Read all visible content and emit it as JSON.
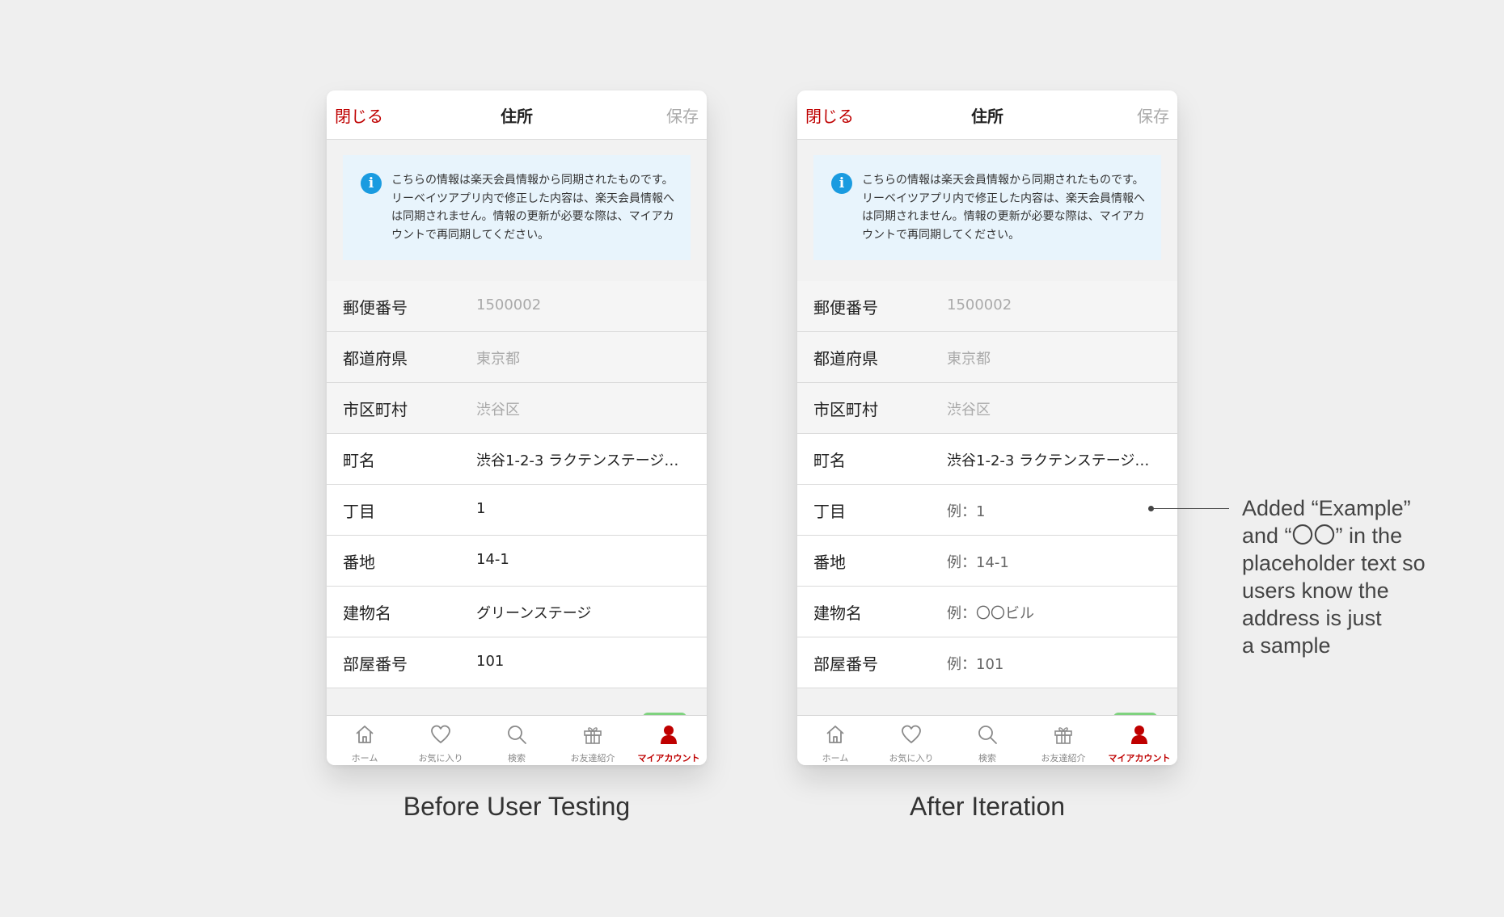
{
  "screens": [
    {
      "nav": {
        "close": "閉じる",
        "title": "住所",
        "save": "保存"
      },
      "notice": "こちらの情報は楽天会員情報から同期されたものです。リーベイツアプリ内で修正した内容は、楽天会員情報へは同期されません。情報の更新が必要な際は、マイアカウントで再同期してください。",
      "fields": [
        {
          "label": "郵便番号",
          "value": "1500002"
        },
        {
          "label": "都道府県",
          "value": "東京都"
        },
        {
          "label": "市区町村",
          "value": "渋谷区"
        },
        {
          "label": "町名",
          "value": "渋谷1-2-3 ラクテンステージ…"
        },
        {
          "label": "丁目",
          "value": "1"
        },
        {
          "label": "番地",
          "value": "14-1"
        },
        {
          "label": "建物名",
          "value": "グリーンステージ"
        },
        {
          "label": "部屋番号",
          "value": "101"
        }
      ],
      "tabs": [
        "ホーム",
        "お気に入り",
        "検索",
        "お友達紹介",
        "マイアカウント"
      ],
      "caption": "Before User Testing"
    },
    {
      "nav": {
        "close": "閉じる",
        "title": "住所",
        "save": "保存"
      },
      "notice": "こちらの情報は楽天会員情報から同期されたものです。リーベイツアプリ内で修正した内容は、楽天会員情報へは同期されません。情報の更新が必要な際は、マイアカウントで再同期してください。",
      "fields": [
        {
          "label": "郵便番号",
          "value": "1500002"
        },
        {
          "label": "都道府県",
          "value": "東京都"
        },
        {
          "label": "市区町村",
          "value": "渋谷区"
        },
        {
          "label": "町名",
          "value": "渋谷1-2-3 ラクテンステージ…"
        },
        {
          "label": "丁目",
          "value": "例：1"
        },
        {
          "label": "番地",
          "value": "例：14-1"
        },
        {
          "label": "建物名",
          "value": "例：〇〇ビル"
        },
        {
          "label": "部屋番号",
          "value": "例：101"
        }
      ],
      "tabs": [
        "ホーム",
        "お気に入り",
        "検索",
        "お友達紹介",
        "マイアカウント"
      ],
      "caption": "After Iteration"
    }
  ],
  "annotation": {
    "lines": [
      "Added “Example”",
      "and “〇〇” in the",
      "placeholder text so",
      "users know the",
      "address is just",
      "a sample"
    ]
  },
  "colors": {
    "brand_red": "#bf0000",
    "info_blue": "#1a9be0",
    "notice_bg": "#e8f4fc"
  },
  "icons": [
    "home-icon",
    "heart-icon",
    "search-icon",
    "gift-icon",
    "person-icon",
    "info-icon"
  ]
}
